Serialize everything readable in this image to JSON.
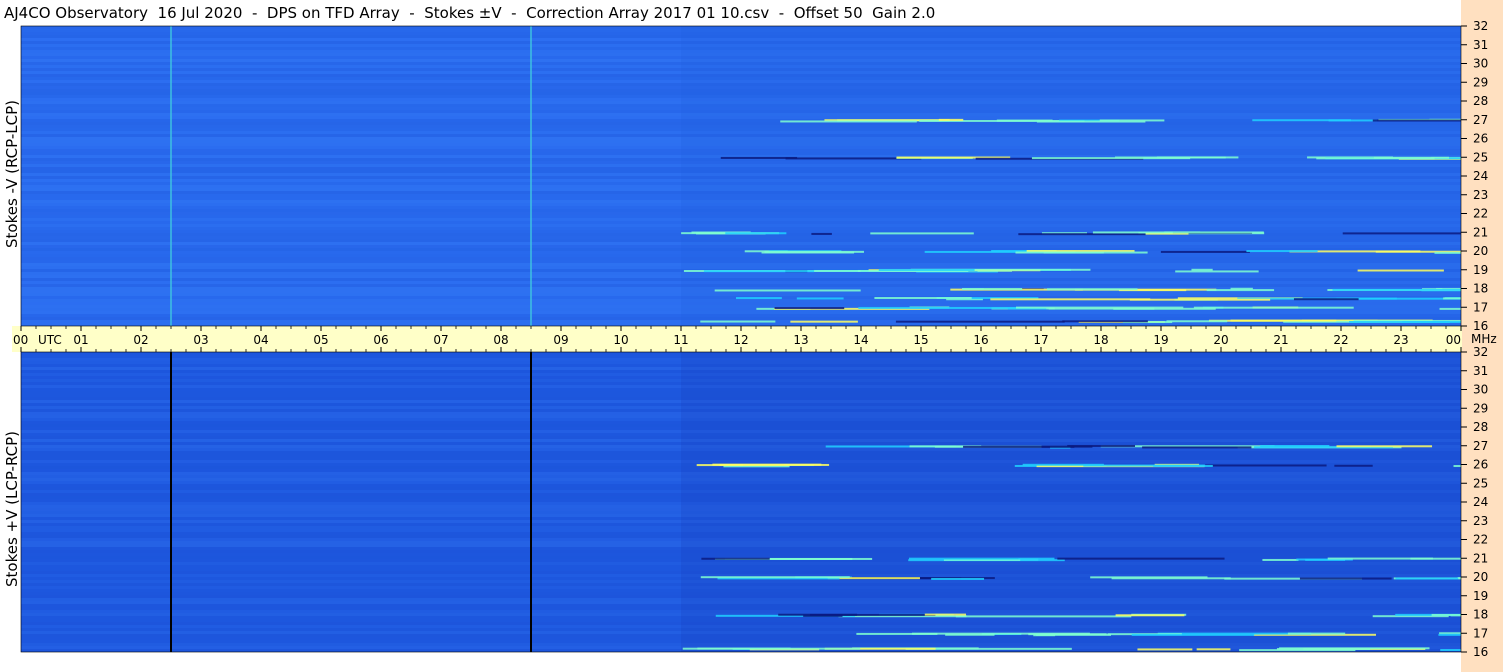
{
  "chart_data": {
    "type": "heatmap",
    "title": "AJ4CO Observatory  16 Jul 2020  -  DPS on TFD Array  -  Stokes ±V  -  Correction Array 2017 01 10.csv  -  Offset 50  Gain 2.0",
    "x_axis": {
      "unit_label": "UTC",
      "tick_labels": [
        "00",
        "01",
        "02",
        "03",
        "04",
        "05",
        "06",
        "07",
        "08",
        "09",
        "10",
        "11",
        "12",
        "13",
        "14",
        "15",
        "16",
        "17",
        "18",
        "19",
        "20",
        "21",
        "22",
        "23",
        "00"
      ],
      "range_hours": [
        0,
        24
      ]
    },
    "y_axis": {
      "unit_label": "MHz",
      "tick_labels": [
        "32",
        "31",
        "30",
        "29",
        "28",
        "27",
        "26",
        "25",
        "24",
        "23",
        "22",
        "21",
        "20",
        "19",
        "18",
        "17",
        "16"
      ],
      "range_mhz": [
        16,
        32
      ]
    },
    "panels": [
      {
        "ylabel": "Stokes -V (RCP-LCP)",
        "base_color": "#2a6cf0",
        "vertical_marks_utc": [
          2.5,
          8.5
        ],
        "vertical_mark_color": "#3ec8e0",
        "bright_bands_mhz": [
          27.0,
          25.0,
          21.0,
          20.0,
          19.0,
          18.0,
          17.5,
          17.0,
          16.3
        ],
        "active_region_utc": [
          11.0,
          24.0
        ]
      },
      {
        "ylabel": "Stokes +V (LCP-RCP)",
        "base_color": "#1e58e0",
        "vertical_marks_utc": [
          2.5,
          8.5
        ],
        "vertical_mark_color": "#000000",
        "bright_bands_mhz": [
          27.0,
          26.0,
          21.0,
          20.0,
          18.0,
          17.0,
          16.2
        ],
        "active_region_utc": [
          11.0,
          24.0
        ]
      }
    ]
  }
}
